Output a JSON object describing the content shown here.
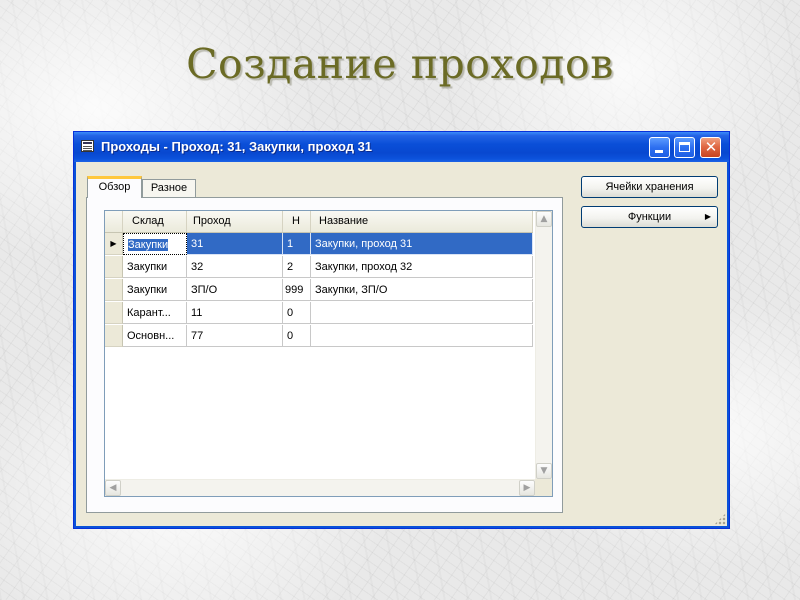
{
  "slide": {
    "title": "Создание проходов"
  },
  "window": {
    "title": "Проходы - Проход: 31, Закупки, проход 31",
    "controls": {
      "minimize_icon": "minimize-icon",
      "maximize_icon": "maximize-icon",
      "close_icon": "close-icon",
      "close_glyph": "✕"
    },
    "accent_color": "#0a4fd8",
    "selection_color": "#316ac5"
  },
  "tabs": [
    {
      "label": "Обзор",
      "active": true
    },
    {
      "label": "Разное",
      "active": false
    }
  ],
  "grid": {
    "columns": [
      "Склад",
      "Проход",
      "Н",
      "Название"
    ],
    "rows": [
      {
        "selected": true,
        "indicator": "▶",
        "cells": [
          "Закупки",
          "31",
          "1",
          "Закупки, проход 31"
        ]
      },
      {
        "selected": false,
        "indicator": "",
        "cells": [
          "Закупки",
          "32",
          "2",
          "Закупки, проход 32"
        ]
      },
      {
        "selected": false,
        "indicator": "",
        "cells": [
          "Закупки",
          "ЗП/О",
          "999",
          "Закупки, ЗП/О"
        ]
      },
      {
        "selected": false,
        "indicator": "",
        "cells": [
          "Карант...",
          "11",
          "0",
          ""
        ]
      },
      {
        "selected": false,
        "indicator": "",
        "cells": [
          "Основн...",
          "77",
          "0",
          ""
        ]
      }
    ],
    "scroll_glyphs": {
      "up": "▲",
      "down": "▼",
      "left": "◀",
      "right": "▶"
    }
  },
  "buttons": {
    "cells_label": "Ячейки хранения",
    "functions_label": "Функции",
    "functions_arrow": "▶"
  }
}
